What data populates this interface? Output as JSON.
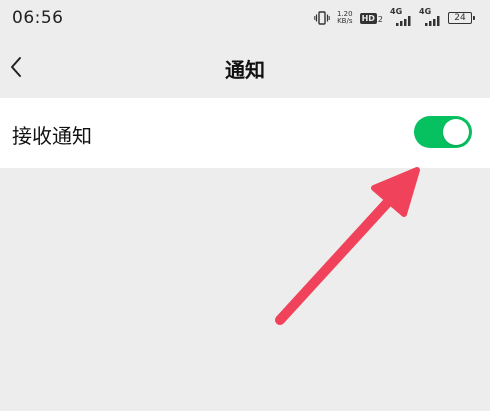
{
  "status_bar": {
    "time": "06:56",
    "net_speed_value": "1.20",
    "net_speed_unit": "KB/s",
    "hd_label": "HD",
    "hd_sub": "2",
    "sig1_label": "4G",
    "sig2_label": "4G",
    "battery_level": "24",
    "icons": [
      "vibrate-icon",
      "hd-voice-icon",
      "signal-icon",
      "signal-icon",
      "battery-icon"
    ]
  },
  "nav": {
    "back_icon": "chevron-left-icon",
    "title": "通知"
  },
  "settings": {
    "receive_notifications": {
      "label": "接收通知",
      "enabled": true
    }
  },
  "colors": {
    "toggle_on": "#07c160",
    "annotation_arrow": "#f0425a",
    "background": "#ededed"
  }
}
